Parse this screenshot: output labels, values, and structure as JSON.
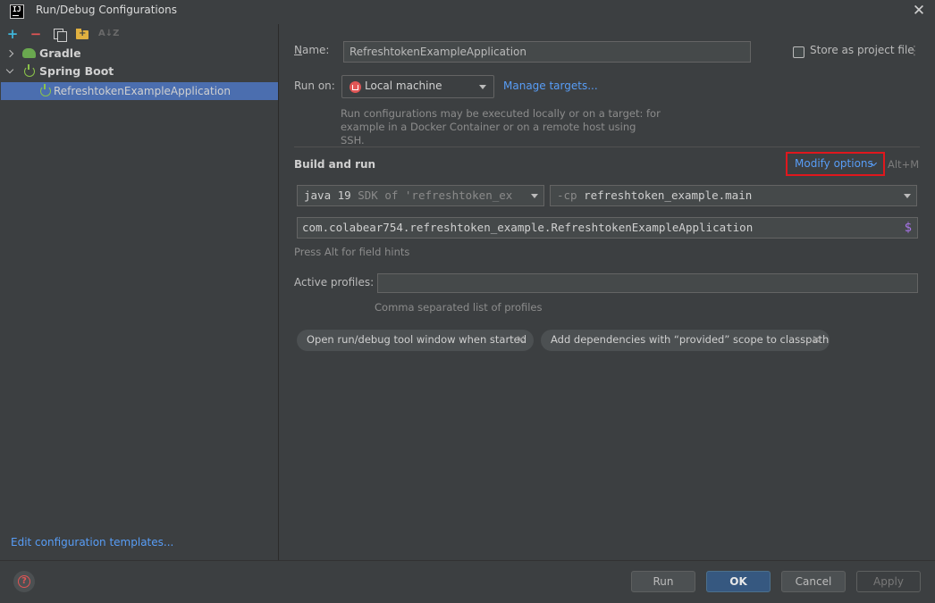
{
  "window": {
    "title": "Run/Debug Configurations",
    "logo_text": "IJ"
  },
  "toolbar": {
    "sort_label": "A↓Z"
  },
  "tree": {
    "gradle_label": "Gradle",
    "spring_label": "Spring Boot",
    "selected_app_label": "RefreshtokenExampleApplication"
  },
  "left_footer": {
    "edit_templates": "Edit configuration templates..."
  },
  "form": {
    "name_label_prefix": "N",
    "name_label_rest": "ame:",
    "name_value": "RefreshtokenExampleApplication",
    "store_as_project_file": "Store as project file",
    "run_on_label": "Run on:",
    "run_on_value": "Local machine",
    "manage_targets": "Manage targets...",
    "run_on_hint": "Run configurations may be executed locally or on a target: for example in a Docker Container or on a remote host using SSH.",
    "section_title": "Build and run",
    "modify_options": "Modify options",
    "modify_shortcut": "Alt+M",
    "jre_main": "java 19",
    "jre_dim": " SDK of 'refreshtoken_ex",
    "cp_dim": "-cp ",
    "cp_main": "refreshtoken_example.main",
    "main_class": "com.colabear754.refreshtoken_example.RefreshtokenExampleApplication",
    "main_class_macro": "$",
    "alt_hint": "Press Alt for field hints",
    "active_profiles_label": "Active profiles:",
    "active_profiles_value": "",
    "active_profiles_hint": "Comma separated list of profiles",
    "chips": [
      "Open run/debug tool window when started",
      "Add dependencies with “provided” scope to classpath"
    ],
    "chip_close": "×"
  },
  "footer": {
    "run": "Run",
    "ok": "OK",
    "cancel": "Cancel",
    "apply": "Apply"
  },
  "colors": {
    "accent_link": "#589df6",
    "selection": "#4b6eaf",
    "highlight_box": "#e0171d",
    "ok_button": "#365880"
  }
}
